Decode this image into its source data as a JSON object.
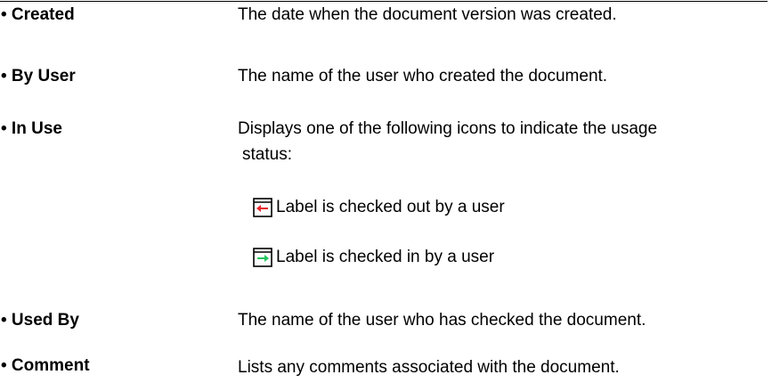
{
  "rows": [
    {
      "term": "• Created",
      "desc": "The date when the document version was created."
    },
    {
      "term": "• By User",
      "desc": "The name of the user who created the document."
    },
    {
      "term": "• In Use",
      "desc_line1": "Displays one of the following icons to indicate the usage",
      "desc_line2": "status:"
    },
    {
      "term": "• Used By",
      "desc": "The name of the user who has checked the document."
    },
    {
      "term": "• Comment",
      "desc": "Lists any comments associated with the document."
    }
  ],
  "status_items": [
    {
      "icon": "checked-out-icon",
      "arrow_color": "#e8262c",
      "label": "Label is checked out by a user"
    },
    {
      "icon": "checked-in-icon",
      "arrow_color": "#22c55e",
      "label": "Label is checked in by a user"
    }
  ]
}
